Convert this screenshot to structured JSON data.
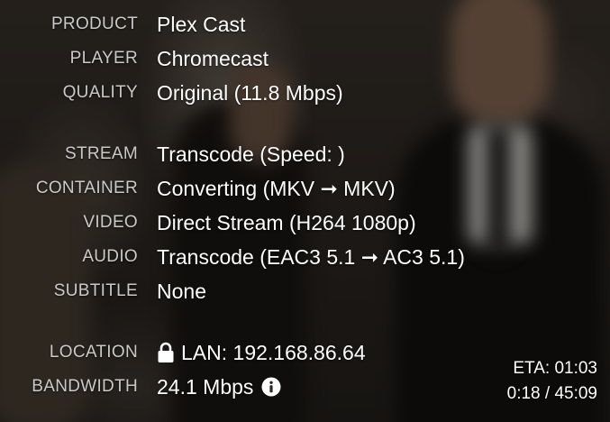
{
  "rows": {
    "product": {
      "label": "PRODUCT",
      "value": "Plex Cast"
    },
    "player": {
      "label": "PLAYER",
      "value": "Chromecast"
    },
    "quality": {
      "label": "QUALITY",
      "value": "Original (11.8 Mbps)"
    },
    "stream": {
      "label": "STREAM",
      "value": "Transcode (Speed: )"
    },
    "container": {
      "label": "CONTAINER",
      "value": "Converting (MKV ➞ MKV)"
    },
    "video": {
      "label": "VIDEO",
      "value": "Direct Stream (H264 1080p)"
    },
    "audio": {
      "label": "AUDIO",
      "value": "Transcode (EAC3 5.1 ➞ AC3 5.1)"
    },
    "subtitle": {
      "label": "SUBTITLE",
      "value": "None"
    },
    "location": {
      "label": "LOCATION",
      "value": "LAN: 192.168.86.64",
      "icon": "lock-icon"
    },
    "bandwidth": {
      "label": "BANDWIDTH",
      "value": "24.1 Mbps",
      "icon": "info-icon"
    }
  },
  "playback": {
    "eta": "ETA: 01:03",
    "progress": "0:18 / 45:09"
  },
  "colors": {
    "label": "#c9c9c9",
    "value": "#ffffff"
  }
}
